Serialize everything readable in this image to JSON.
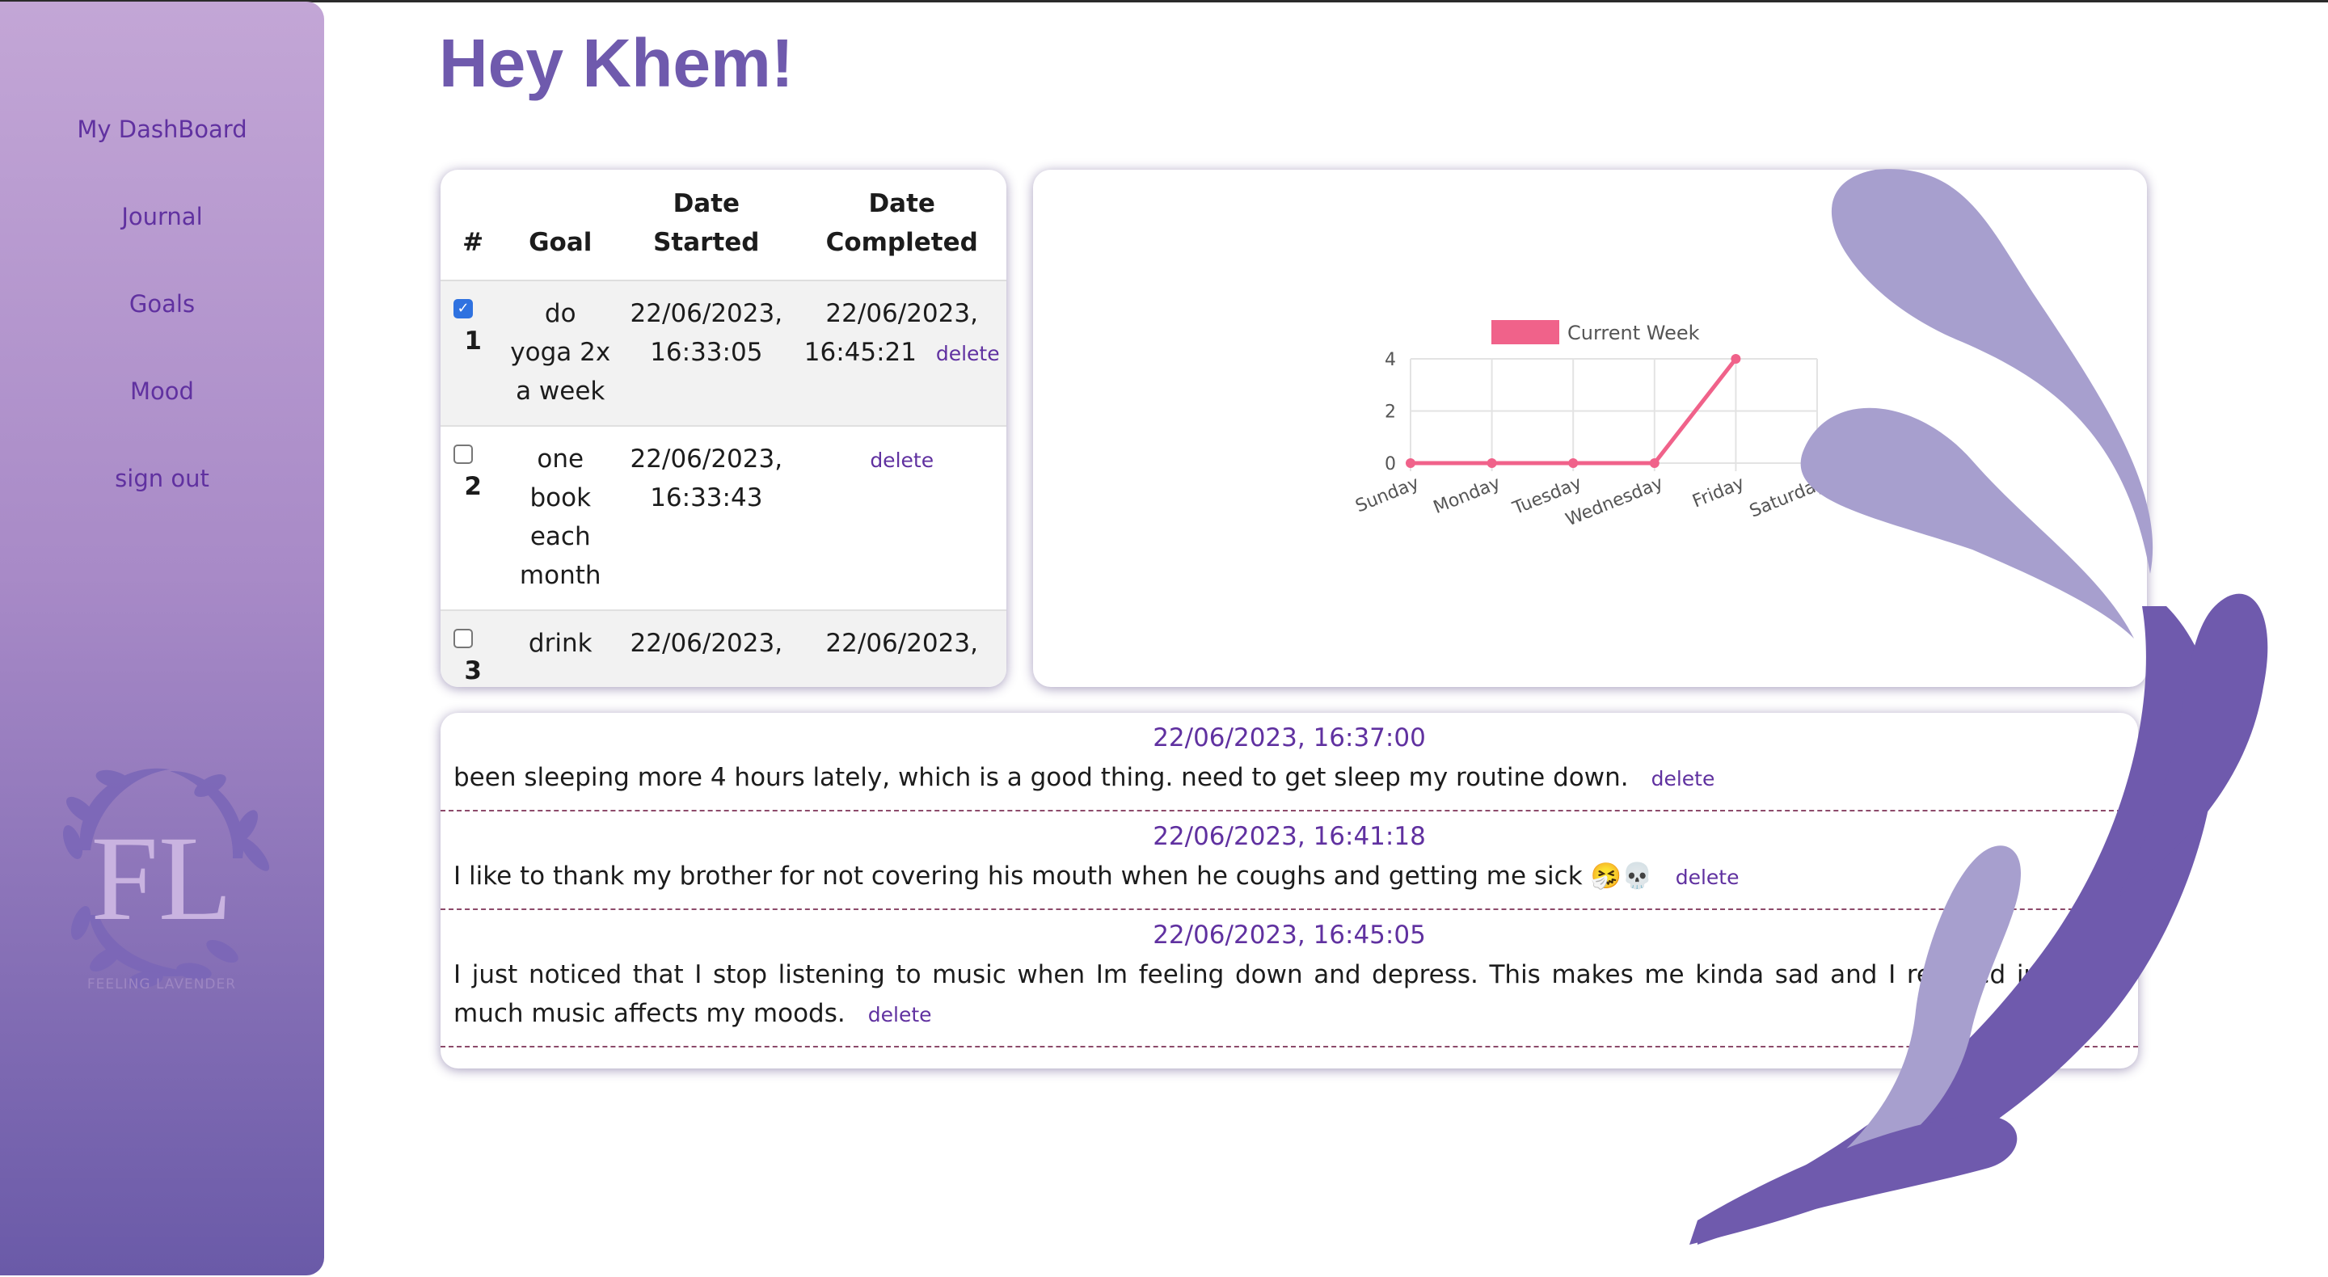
{
  "greeting": "Hey Khem!",
  "sidebar": {
    "items": [
      {
        "label": "My DashBoard"
      },
      {
        "label": "Journal"
      },
      {
        "label": "Goals"
      },
      {
        "label": "Mood"
      },
      {
        "label": "sign out"
      }
    ],
    "logo_caption": "FEELING LAVENDER",
    "logo_letters": "FL"
  },
  "goals": {
    "headers": [
      "#",
      "Goal",
      "Date Started",
      "Date Completed"
    ],
    "rows": [
      {
        "num": "1",
        "checked": true,
        "goal": "do yoga 2x a week",
        "started": "22/06/2023, 16:33:05",
        "completed": "22/06/2023, 16:45:21",
        "delete": "delete"
      },
      {
        "num": "2",
        "checked": false,
        "goal": "one book each month",
        "started": "22/06/2023, 16:33:43",
        "completed": "",
        "delete": "delete"
      },
      {
        "num": "3",
        "checked": false,
        "goal": "drink",
        "started": "22/06/2023,",
        "completed": "22/06/2023,",
        "delete": ""
      }
    ]
  },
  "chart_data": {
    "type": "line",
    "categories": [
      "Sunday",
      "Monday",
      "Tuesday",
      "Wednesday",
      "Friday",
      "Saturday"
    ],
    "series": [
      {
        "name": "Current Week",
        "values": [
          0,
          0,
          0,
          0,
          4,
          null
        ],
        "color": "#f0628a"
      }
    ],
    "ylim": [
      0,
      4
    ],
    "yticks": [
      0,
      2,
      4
    ],
    "legend": "top",
    "grid": true
  },
  "journal": {
    "entries": [
      {
        "timestamp": "22/06/2023, 16:37:00",
        "text": "been sleeping more 4 hours lately, which is a good thing. need to get sleep my routine down.",
        "delete": "delete"
      },
      {
        "timestamp": "22/06/2023, 16:41:18",
        "text": "I like to thank my brother for not covering his mouth when he coughs and getting me sick 🤧💀",
        "delete": "delete"
      },
      {
        "timestamp": "22/06/2023, 16:45:05",
        "text": "I just noticed that I stop listening to music when Im feeling down and depress. This makes me kinda sad and I realized just how much music affects my moods.",
        "delete": "delete"
      }
    ]
  },
  "colors": {
    "accent": "#6031a0",
    "heading": "#6f5aad",
    "sidebar_top": "#c3a6d6",
    "sidebar_bottom": "#6a5aa8"
  }
}
